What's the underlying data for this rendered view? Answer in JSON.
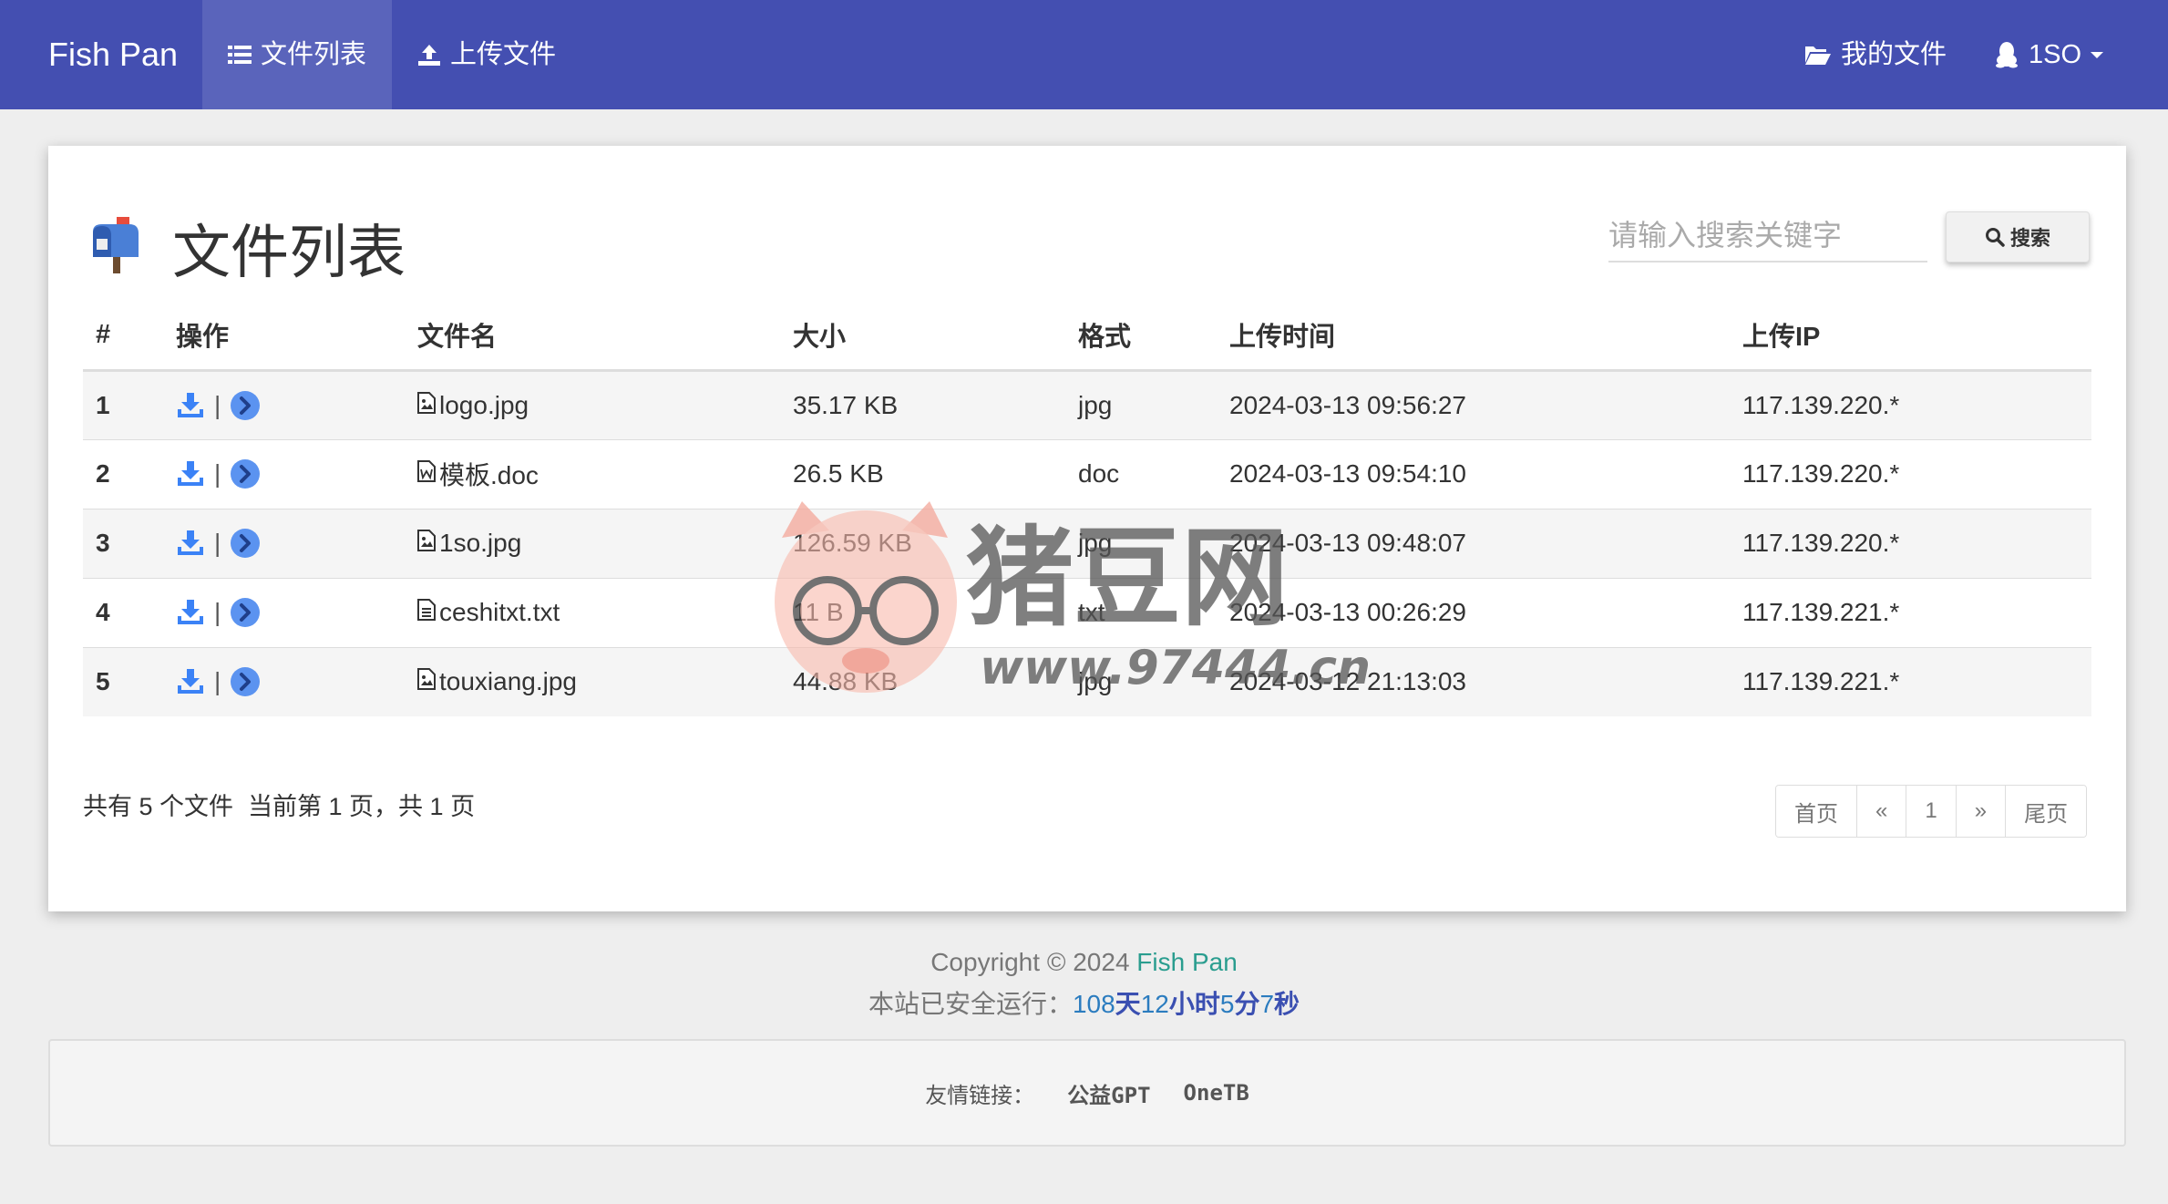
{
  "navbar": {
    "brand": "Fish Pan",
    "items": [
      {
        "label": "文件列表",
        "active": true
      },
      {
        "label": "上传文件",
        "active": false
      }
    ],
    "my_files": "我的文件",
    "user": "1SO"
  },
  "main": {
    "title": "文件列表",
    "search_placeholder": "请输入搜索关键字",
    "search_button": "搜索",
    "table": {
      "headers": [
        "#",
        "操作",
        "文件名",
        "大小",
        "格式",
        "上传时间",
        "上传IP"
      ],
      "rows": [
        {
          "num": "1",
          "name": "logo.jpg",
          "type_icon": "image-file-icon",
          "size": "35.17 KB",
          "format": "jpg",
          "time": "2024-03-13 09:56:27",
          "ip": "117.139.220.*"
        },
        {
          "num": "2",
          "name": "模板.doc",
          "type_icon": "word-file-icon",
          "size": "26.5 KB",
          "format": "doc",
          "time": "2024-03-13 09:54:10",
          "ip": "117.139.220.*"
        },
        {
          "num": "3",
          "name": "1so.jpg",
          "type_icon": "image-file-icon",
          "size": "126.59 KB",
          "format": "jpg",
          "time": "2024-03-13 09:48:07",
          "ip": "117.139.220.*"
        },
        {
          "num": "4",
          "name": "ceshitxt.txt",
          "type_icon": "text-file-icon",
          "size": "11 B",
          "format": "txt",
          "time": "2024-03-13 00:26:29",
          "ip": "117.139.221.*"
        },
        {
          "num": "5",
          "name": "touxiang.jpg",
          "type_icon": "image-file-icon",
          "size": "44.88 KB",
          "format": "jpg",
          "time": "2024-03-12 21:13:03",
          "ip": "117.139.221.*"
        }
      ]
    },
    "summary": {
      "total": "共有 5 个文件",
      "page": "当前第 1 页，共 1 页"
    },
    "pagination": [
      "首页",
      "«",
      "1",
      "»",
      "尾页"
    ]
  },
  "footer": {
    "copyright_prefix": "Copyright © 2024",
    "copyright_brand": "Fish Pan",
    "uptime_label": "本站已安全运行：",
    "uptime": {
      "days": "108",
      "days_unit": "天",
      "hours": "12",
      "hours_unit": "小时",
      "minutes": "5",
      "minutes_unit": "分",
      "seconds": "7",
      "seconds_unit": "秒"
    },
    "links_label": "友情链接：",
    "links": [
      "公益GPT",
      "OneTB"
    ]
  },
  "watermark": {
    "brand": "猪豆网",
    "url": "www.97444.cn"
  },
  "colors": {
    "navbar": "#444fb1",
    "accent": "#3b82f6",
    "format_link": "#1a1adb"
  }
}
